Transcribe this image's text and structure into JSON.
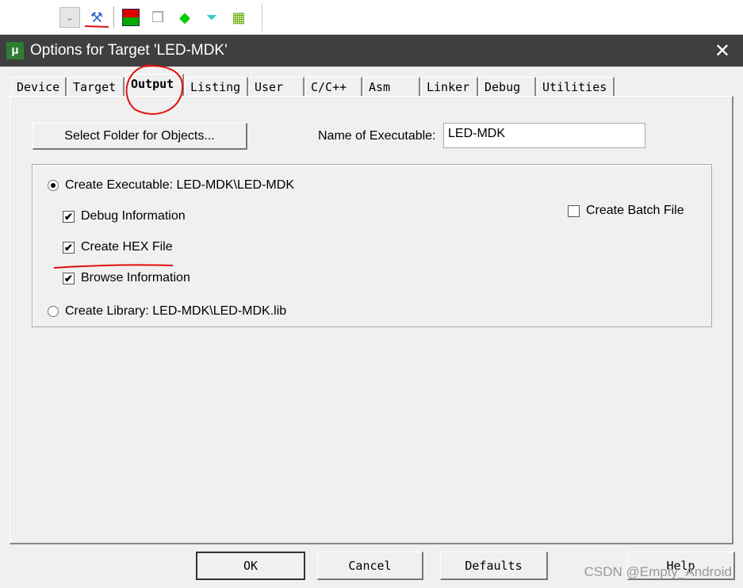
{
  "toolbar": {
    "icons": [
      "dropdown-icon",
      "target-options-wand-icon",
      "build-icon",
      "windows-icon",
      "manage-components-icon",
      "filter-icon",
      "pack-installer-icon"
    ]
  },
  "dialog": {
    "title": "Options for Target 'LED-MDK'",
    "logo_text": "μ"
  },
  "tabs": [
    "Device",
    "Target",
    "Output",
    "Listing",
    "User",
    "C/C++",
    "Asm",
    "Linker",
    "Debug",
    "Utilities"
  ],
  "active_tab": "Output",
  "output": {
    "select_folder_label": "Select Folder for Objects...",
    "name_label": "Name of Executable:",
    "name_value": "LED-MDK",
    "create_executable": "Create Executable:  LED-MDK\\LED-MDK",
    "debug_info": "Debug Information",
    "create_hex": "Create HEX File",
    "browse_info": "Browse Information",
    "create_library": "Create Library:  LED-MDK\\LED-MDK.lib",
    "create_batch": "Create Batch File",
    "checks": {
      "debug_info": true,
      "create_hex": true,
      "browse_info": true,
      "create_batch": false
    },
    "selected_radio": "create_executable"
  },
  "buttons": {
    "ok": "OK",
    "cancel": "Cancel",
    "defaults": "Defaults",
    "help": "Help"
  },
  "watermark": "CSDN @Empty_Android",
  "annotation_color": "#e01010"
}
